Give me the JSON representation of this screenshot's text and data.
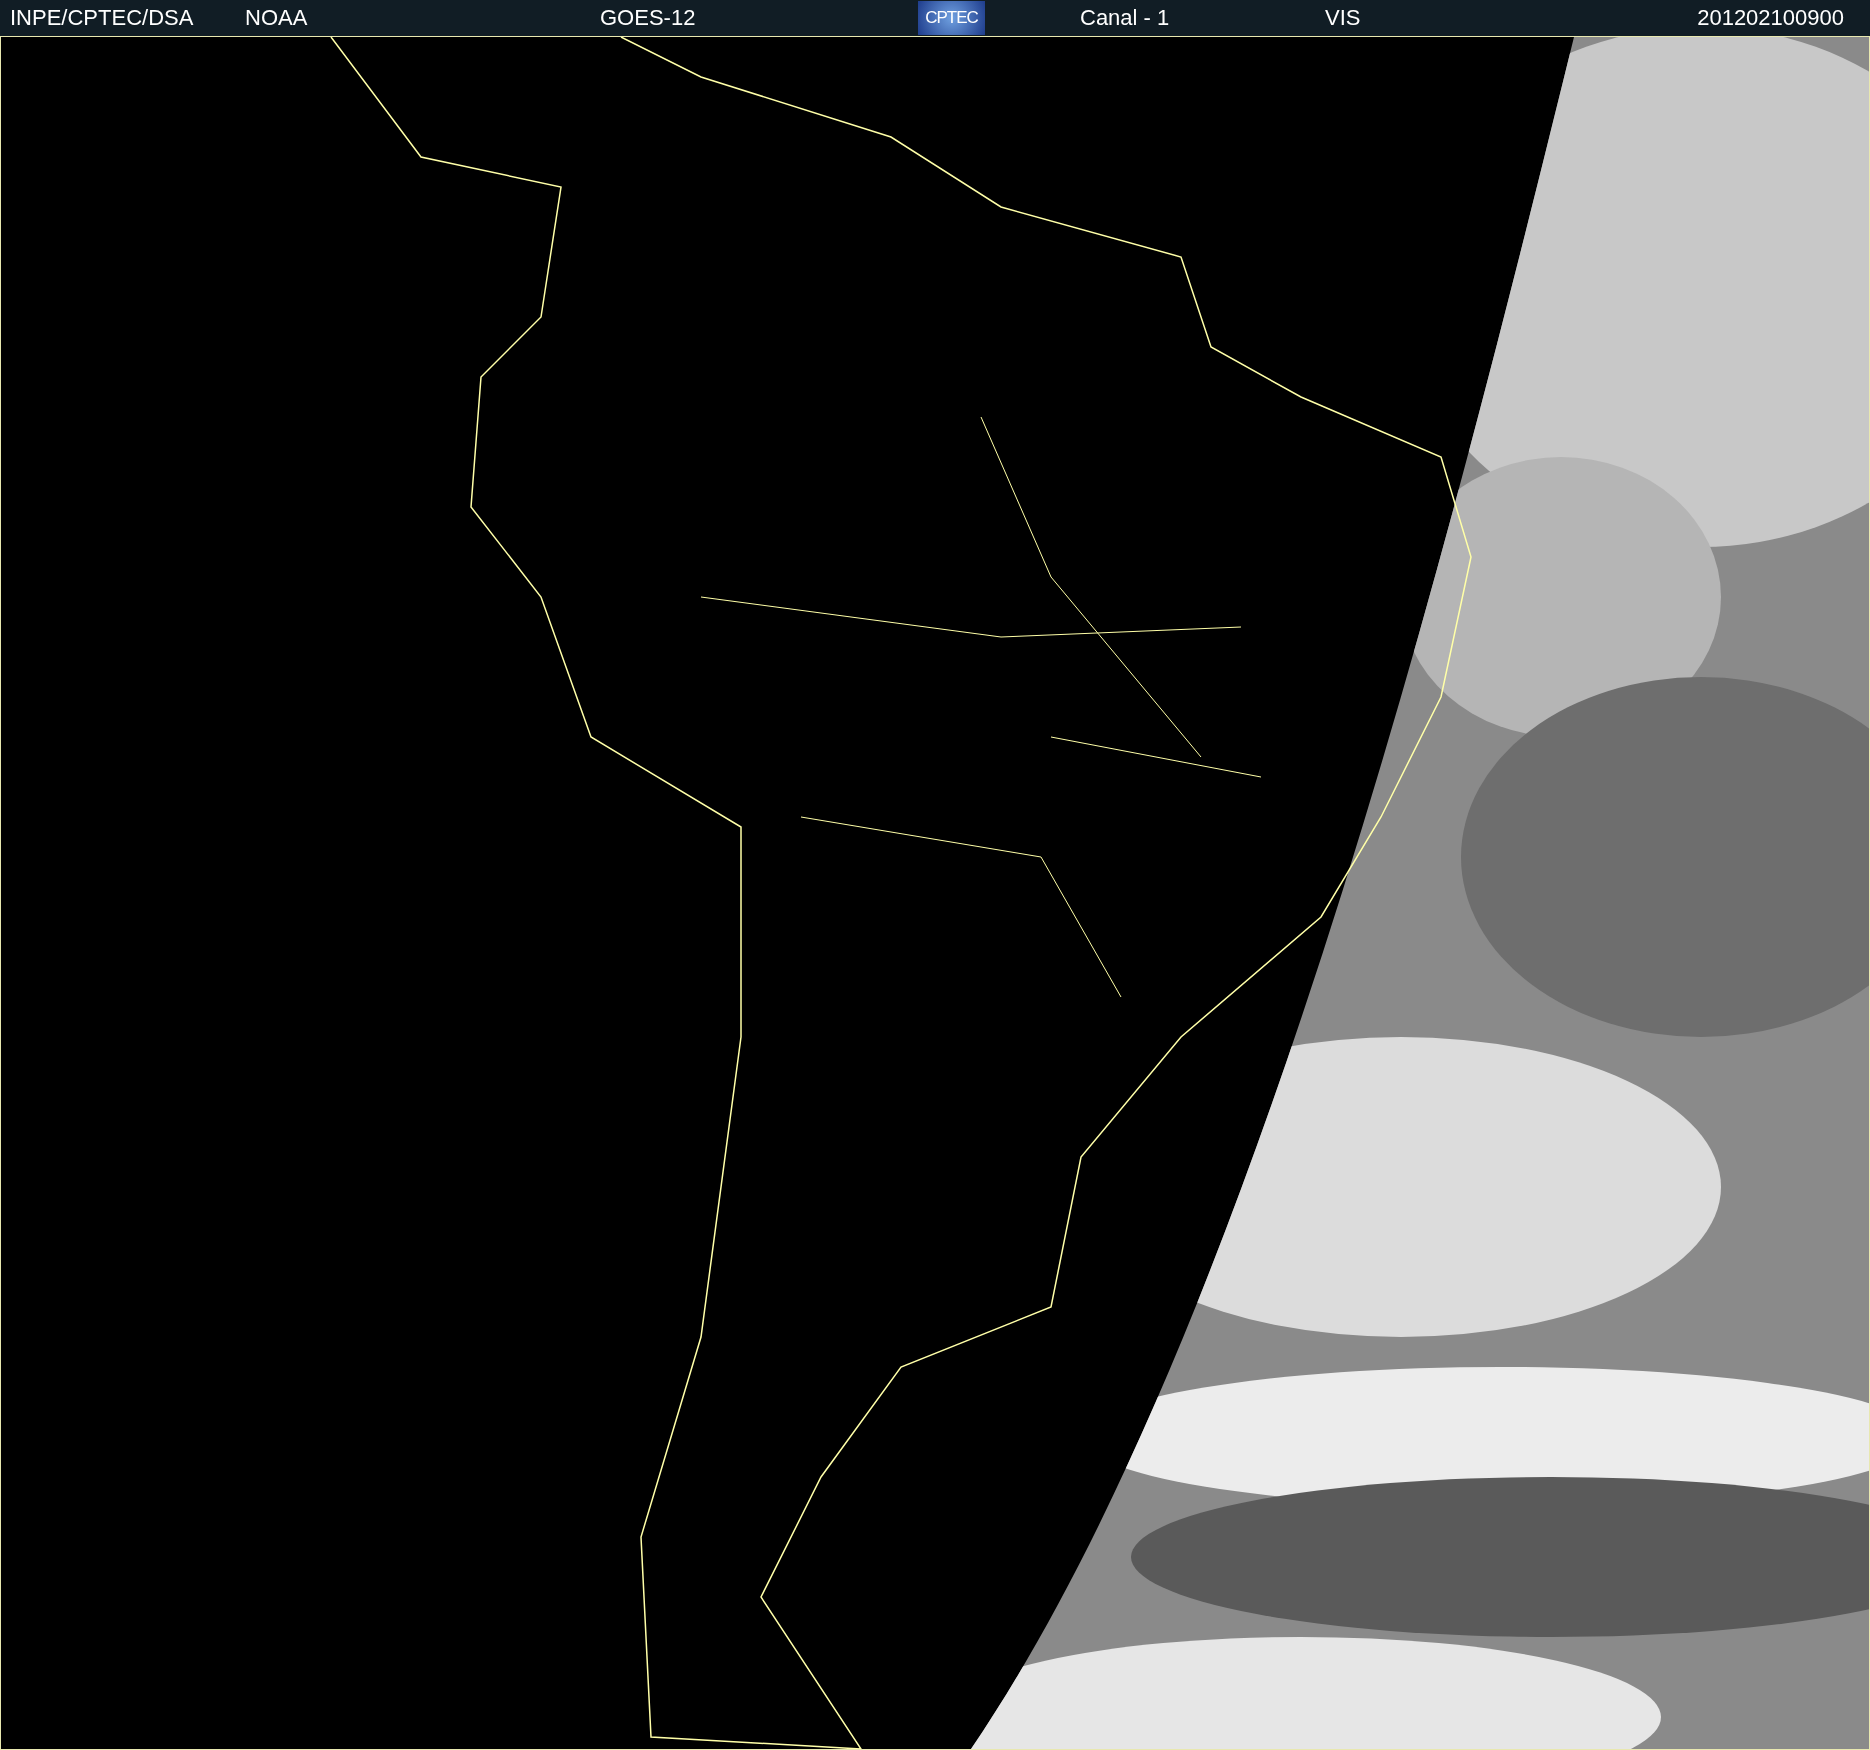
{
  "header": {
    "items": [
      {
        "kind": "text",
        "text": "INPE/CPTEC/DSA"
      },
      {
        "kind": "text",
        "text": "NOAA"
      },
      {
        "kind": "text",
        "text": "GOES-12"
      },
      {
        "kind": "logo",
        "text": "CPTEC"
      },
      {
        "kind": "text",
        "text": "Canal - 1"
      },
      {
        "kind": "text",
        "text": "VIS"
      },
      {
        "kind": "text",
        "text": "201202100900"
      }
    ]
  }
}
